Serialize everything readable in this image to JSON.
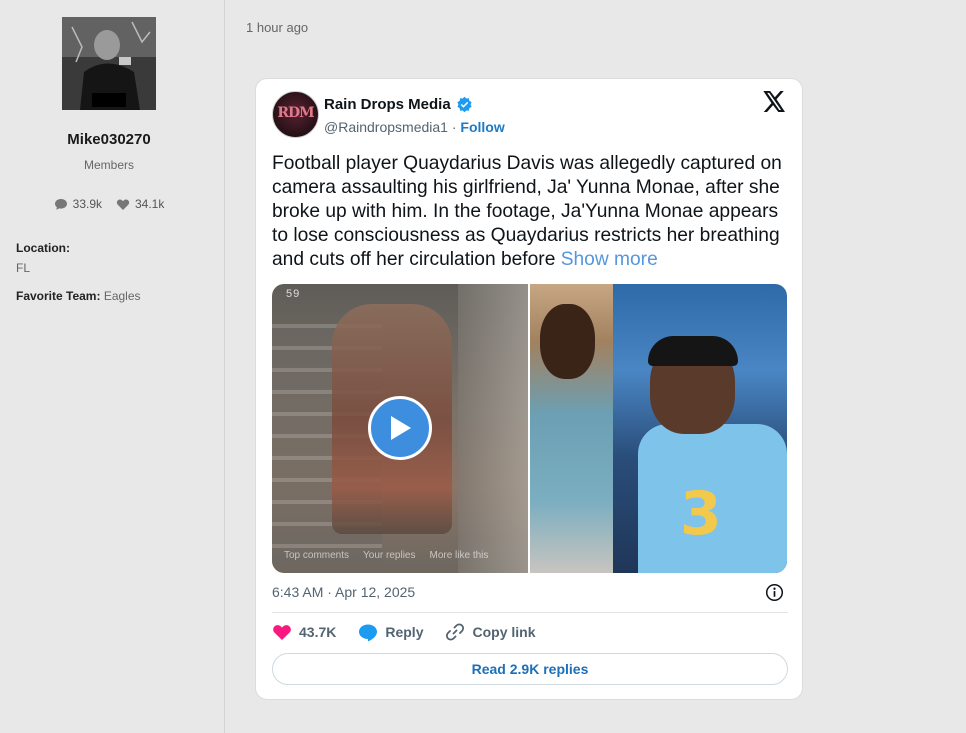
{
  "profile": {
    "username": "Mike030270",
    "group": "Members",
    "messages": "33.9k",
    "reactions": "34.1k",
    "location_label": "Location:",
    "location_value": "FL",
    "team_label": "Favorite Team:",
    "team_value": "Eagles",
    "avatar_badge": "PARENTAL ADVISORY"
  },
  "post": {
    "time_ago": "1 hour ago"
  },
  "tweet": {
    "avatar_text": "RDM",
    "name": "Rain Drops Media",
    "handle": "@Raindropsmedia1",
    "separator": "·",
    "follow": "Follow",
    "text": "Football player Quaydarius Davis was allegedly captured on camera assaulting his girlfriend, Ja' Yunna Monae, after she broke up with him. In the footage, Ja'Yunna Monae appears to lose consciousness as Quaydarius restricts her breathing and cuts off her circulation before ",
    "show_more": "Show more",
    "video_counter": "59",
    "video_overlay": [
      "Top comments",
      "Your replies",
      "More like this"
    ],
    "jersey_number": "3",
    "timestamp": "6:43 AM · Apr 12, 2025",
    "likes": "43.7K",
    "reply": "Reply",
    "copy_link": "Copy link",
    "read_replies": "Read 2.9K replies"
  },
  "colors": {
    "accent": "#1d7bc6",
    "verified": "#1d9bf0",
    "heart": "#f91880",
    "play": "#3e8ee0"
  },
  "icons": [
    "comment-icon",
    "heart-icon",
    "verified-badge-icon",
    "x-logo-icon",
    "play-icon",
    "info-icon",
    "reply-icon",
    "link-icon"
  ]
}
